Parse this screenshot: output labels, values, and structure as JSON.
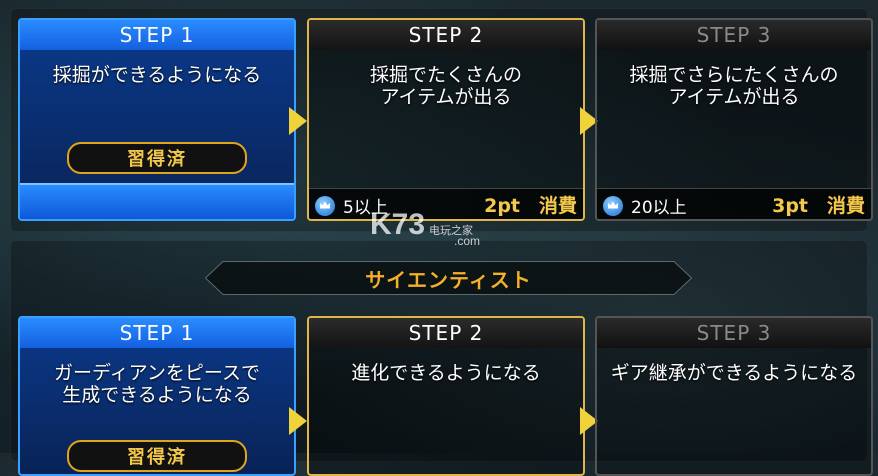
{
  "section1": {
    "steps": [
      {
        "label": "STEP 1",
        "description_lines": [
          "採掘ができるようになる"
        ],
        "badge": "習得済"
      },
      {
        "label": "STEP 2",
        "description_lines": [
          "採掘でたくさんの",
          "アイテムが出る"
        ],
        "level_req": "5以上",
        "cost": "2pt　消費"
      },
      {
        "label": "STEP 3",
        "description_lines": [
          "採掘でさらにたくさんの",
          "アイテムが出る"
        ],
        "level_req": "20以上",
        "cost": "3pt　消費"
      }
    ]
  },
  "section2": {
    "title": "サイエンティスト",
    "steps": [
      {
        "label": "STEP 1",
        "description_lines": [
          "ガーディアンをピースで",
          "生成できるようになる"
        ],
        "badge": "習得済"
      },
      {
        "label": "STEP 2",
        "description_lines": [
          "進化できるようになる"
        ]
      },
      {
        "label": "STEP 3",
        "description_lines": [
          "ギア継承ができるようになる"
        ]
      }
    ]
  },
  "watermark": {
    "brand": "K73",
    "tag": "电玩之家",
    "domain": ".com"
  },
  "colors": {
    "learned_blue": "#1460e0",
    "active_gold": "#e0b64a",
    "accent_orange": "#f4b02a"
  }
}
